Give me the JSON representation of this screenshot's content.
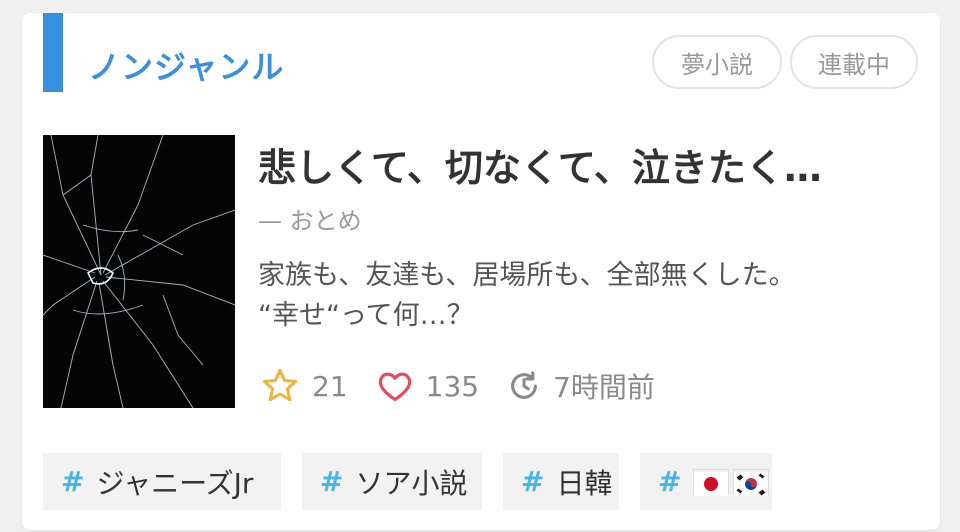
{
  "genre": {
    "label": "ノンジャンル",
    "accent": "#3590e0"
  },
  "badges": [
    {
      "label": "夢小説"
    },
    {
      "label": "連載中"
    }
  ],
  "story": {
    "title": "悲しくて、切なくて、泣きたく…",
    "author": "— おとめ",
    "description_lines": [
      "家族も、友達も、居場所も、全部無くした。",
      "“幸せ“って何…？"
    ],
    "cover_icon": "shattered-glass-image"
  },
  "stats": {
    "stars": "21",
    "likes": "135",
    "updated": "7時間前",
    "star_color": "#f0b43c",
    "heart_color": "#e84a5f"
  },
  "tags": [
    {
      "hash": "#",
      "label": "ジャニーズJr"
    },
    {
      "hash": "#",
      "label": "ソア小説"
    },
    {
      "hash": "#",
      "label": "日韓"
    },
    {
      "hash": "#",
      "label": "",
      "flags": [
        "japan-flag-icon",
        "korea-flag-icon"
      ]
    }
  ]
}
